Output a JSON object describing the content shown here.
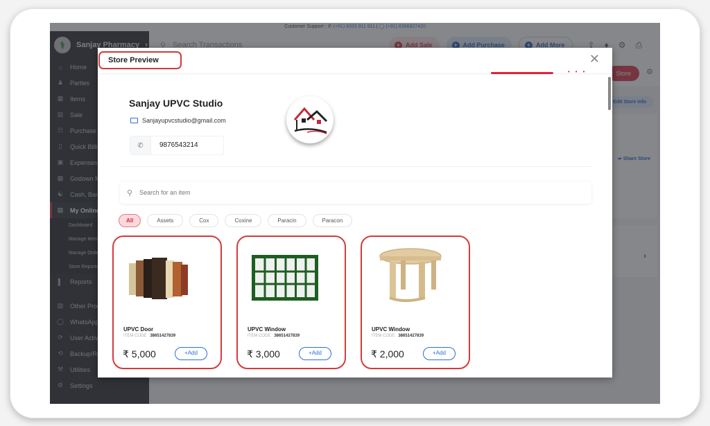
{
  "support": {
    "label": "Customer Support :",
    "phone": "(+91) 9333 911 911",
    "separator": "|",
    "whatsapp": "(+91) 6366827420"
  },
  "sidebar": {
    "company": "Sanjay Pharmacy",
    "items": [
      {
        "label": "Home",
        "icon": "home-icon"
      },
      {
        "label": "Parties",
        "icon": "users-icon"
      },
      {
        "label": "Items",
        "icon": "items-icon"
      },
      {
        "label": "Sale",
        "icon": "sale-icon"
      },
      {
        "label": "Purchase",
        "icon": "cart-icon"
      },
      {
        "label": "Quick Billing",
        "icon": "bill-icon"
      },
      {
        "label": "Expenses",
        "icon": "wallet-icon"
      },
      {
        "label": "Godown Management",
        "icon": "godown-icon"
      },
      {
        "label": "Cash, Bank",
        "icon": "bank-icon"
      },
      {
        "label": "My Online Store",
        "icon": "store-icon"
      }
    ],
    "sub_items": [
      "Dashboard",
      "Manage Items",
      "Manage Orders",
      "Store Reports"
    ],
    "items2": [
      {
        "label": "Reports",
        "icon": "chart-icon"
      },
      {
        "label": "Other Products",
        "icon": "products-icon"
      },
      {
        "label": "WhatsApp",
        "icon": "whatsapp-icon"
      },
      {
        "label": "User Activity",
        "icon": "sync-icon"
      },
      {
        "label": "Backup/Restore",
        "icon": "backup-icon"
      },
      {
        "label": "Utilities",
        "icon": "wrench-icon"
      },
      {
        "label": "Settings",
        "icon": "gear-icon"
      }
    ]
  },
  "topbar": {
    "search_placeholder": "Search Transactions",
    "add_sale": "Add Sale",
    "add_purchase": "Add Purchase",
    "add_more": "Add More"
  },
  "background": {
    "open_store": "Store",
    "edit_store_info": "Edit Store Info",
    "share_store": "Share Store"
  },
  "modal": {
    "title": "Store Preview",
    "close_icon": "close-icon",
    "store": {
      "name": "Sanjay UPVC Studio",
      "email": "Sanjayupvcstudio@gmail.com",
      "phone": "9876543214"
    },
    "search_placeholder": "Search for an item",
    "categories": [
      "All",
      "Assets",
      "Cox",
      "Coxine",
      "Paracin",
      "Paracon"
    ],
    "active_category": "All",
    "products": [
      {
        "name": "UPVC Door",
        "code_label": "ITEM CODE :",
        "code": "38651427839",
        "price": "₹ 5,000",
        "add_label": "+Add"
      },
      {
        "name": "UPVC Window",
        "code_label": "ITEM CODE :",
        "code": "38651427839",
        "price": "₹ 3,000",
        "add_label": "+Add"
      },
      {
        "name": "UPVC Window",
        "code_label": "ITEM CODE :",
        "code": "38651427839",
        "price": "₹ 2,000",
        "add_label": "+Add"
      }
    ]
  },
  "colors": {
    "accent_red": "#d3293f",
    "accent_blue": "#1e5bbd",
    "highlight_border": "#d33a3a",
    "sidebar_bg": "#1d2127"
  }
}
